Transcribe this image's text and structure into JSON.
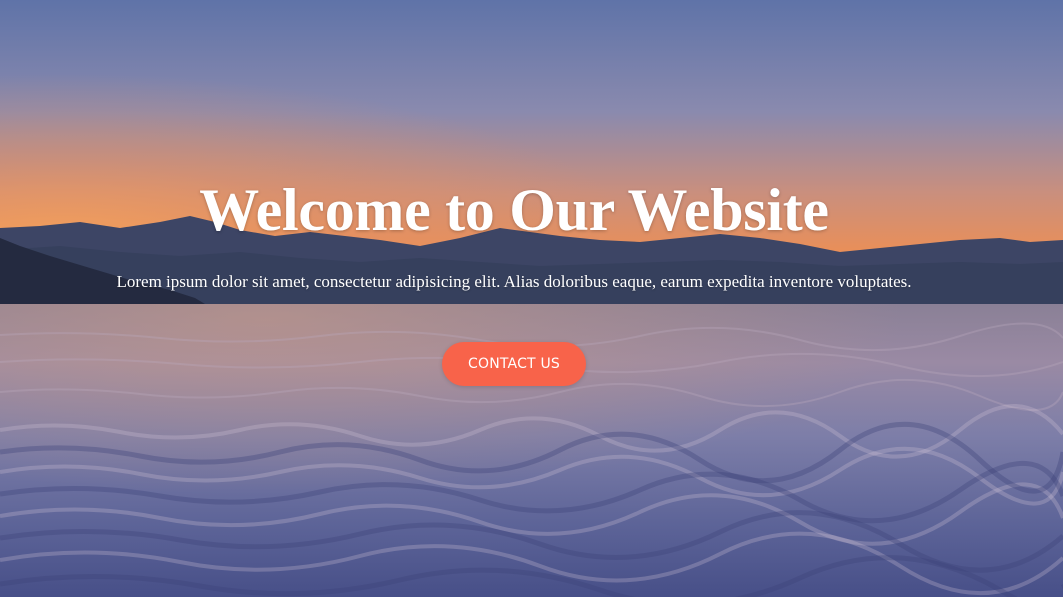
{
  "hero": {
    "title": "Welcome to Our Website",
    "subtitle": "Lorem ipsum dolor sit amet, consectetur adipisicing elit. Alias doloribus eaque, earum expedita inventore voluptates.",
    "cta_label": "CONTACT US"
  },
  "colors": {
    "cta_background": "#f8634a",
    "text": "#ffffff"
  }
}
